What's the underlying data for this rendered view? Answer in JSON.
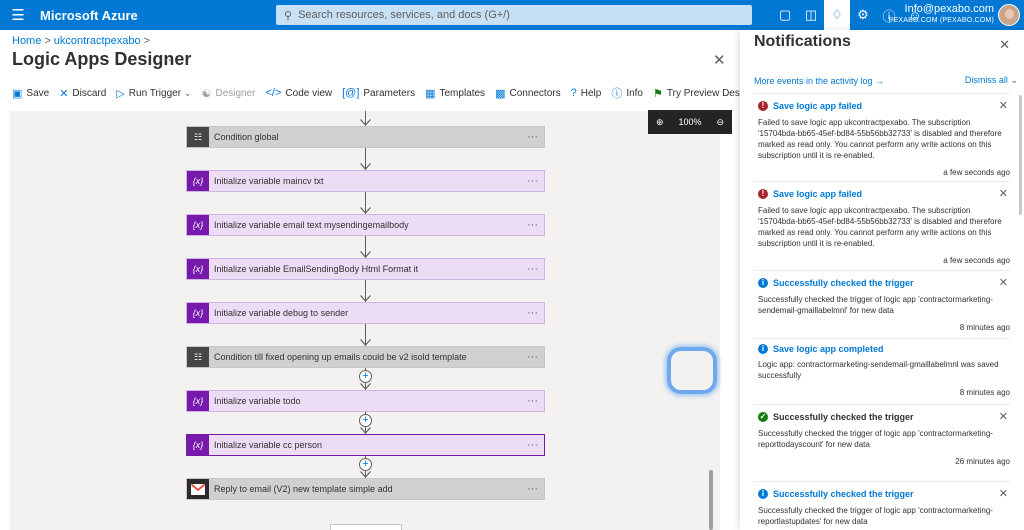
{
  "topbar": {
    "brand": "Microsoft Azure",
    "search_placeholder": "Search resources, services, and docs (G+/)",
    "account_email": "Info@pexabo.com",
    "account_directory": "PEXABO.COM (PEXABO.COM)",
    "icons": [
      "terminal-icon",
      "directory-filter-icon",
      "bell-icon",
      "gear-icon",
      "help-icon",
      "feedback-icon"
    ]
  },
  "breadcrumb": {
    "home": "Home",
    "resource": "ukcontractpexabo"
  },
  "page": {
    "title": "Logic Apps Designer",
    "more": "···"
  },
  "toolbar": {
    "save": "Save",
    "discard": "Discard",
    "run_trigger": "Run Trigger",
    "designer": "Designer",
    "code_view": "Code view",
    "parameters": "Parameters",
    "templates": "Templates",
    "connectors": "Connectors",
    "help": "Help",
    "info": "Info",
    "try_preview": "Try Preview Designer"
  },
  "zoom": {
    "level": "100%"
  },
  "steps": [
    {
      "label": "Condition global",
      "kind": "condition"
    },
    {
      "label": "Initialize variable maincv txt",
      "kind": "variable"
    },
    {
      "label": "Initialize variable email text mysendingemailbody",
      "kind": "variable"
    },
    {
      "label": "Initialize variable EmailSendingBody Html Format it",
      "kind": "variable"
    },
    {
      "label": "Initialize variable debug to sender",
      "kind": "variable"
    },
    {
      "label": "Condition till fixed opening up emails could be v2 isold template",
      "kind": "condition"
    },
    {
      "label": "Initialize variable todo",
      "kind": "variable"
    },
    {
      "label": "Initialize variable cc person",
      "kind": "variable"
    },
    {
      "label": "Reply to email (V2) new template simple add",
      "kind": "gmail"
    }
  ],
  "notifications": {
    "title": "Notifications",
    "more_events": "More events in the activity log →",
    "dismiss_all": "Dismiss all",
    "items": [
      {
        "title": "Save logic app failed",
        "body": "Failed to save logic app ukcontractpexabo. The subscription '15704bda-bb65-45ef-bd84-55b56bb32733' is disabled and therefore marked as read only. You cannot perform any write actions on this subscription until it is re-enabled.",
        "time": "a few seconds ago",
        "status": "error"
      },
      {
        "title": "Save logic app failed",
        "body": "Failed to save logic app ukcontractpexabo. The subscription '15704bda-bb65-45ef-bd84-55b56bb32733' is disabled and therefore marked as read only. You cannot perform any write actions on this subscription until it is re-enabled.",
        "time": "a few seconds ago",
        "status": "error"
      },
      {
        "title": "Successfully checked the trigger",
        "body": "Successfully checked the trigger of logic app 'contractormarketing-sendemail-gmaillabelmnl' for new data",
        "time": "8 minutes ago",
        "status": "info"
      },
      {
        "title": "Save logic app completed",
        "body": "Logic app: contractormarketing-sendemail-gmaillabelmnl was saved successfully",
        "time": "8 minutes ago",
        "status": "info"
      },
      {
        "title": "Successfully checked the trigger",
        "body": "Successfully checked the trigger of logic app 'contractormarketing-reporttodayscount' for new data",
        "time": "26 minutes ago",
        "status": "success"
      },
      {
        "title": "Successfully checked the trigger",
        "body": "Successfully checked the trigger of logic app 'contractormarketing-reportlastupdates' for new data",
        "time": "",
        "status": "info"
      }
    ]
  },
  "colors": {
    "azure_blue": "#0078d4",
    "variable_purple": "#7719aa",
    "condition_gray": "#484644",
    "error_red": "#a4262c",
    "success_green": "#107c10"
  }
}
